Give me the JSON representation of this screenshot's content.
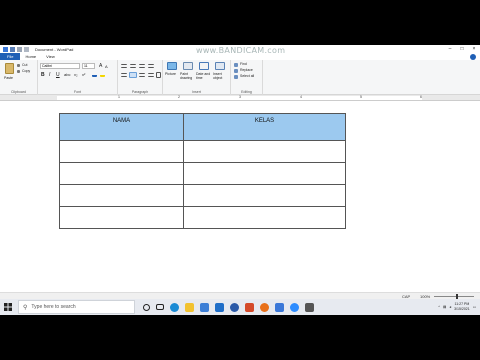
{
  "window": {
    "title": "Document - WordPad",
    "watermark": "www.BANDICAM.com"
  },
  "ribbon_tabs": [
    "File",
    "Home",
    "View"
  ],
  "clipboard": {
    "paste": "Paste",
    "cut": "Cut",
    "copy": "Copy",
    "label": "Clipboard"
  },
  "font": {
    "family": "Calibri",
    "size": "11",
    "label": "Font"
  },
  "paragraph": {
    "label": "Paragraph"
  },
  "insert": {
    "picture": "Picture",
    "paint": "Paint drawing",
    "datetime": "Date and time",
    "object": "Insert object",
    "label": "Insert"
  },
  "editing": {
    "find": "Find",
    "replace": "Replace",
    "select_all": "Select all",
    "label": "Editing"
  },
  "ruler": [
    "1",
    "2",
    "3",
    "4",
    "5",
    "6"
  ],
  "table": {
    "headers": [
      "NAMA",
      "KELAS"
    ],
    "rows": [
      [
        "",
        ""
      ],
      [
        "",
        ""
      ],
      [
        "",
        ""
      ],
      [
        "",
        ""
      ]
    ]
  },
  "status": {
    "caps": "CAP",
    "zoom": "100%"
  },
  "taskbar": {
    "search_placeholder": "Type here to search",
    "time": "11:27 PM",
    "date": "3/15/2021"
  },
  "colors": {
    "accent": "#1f5fb5",
    "table_header": "#9cc9ef"
  }
}
